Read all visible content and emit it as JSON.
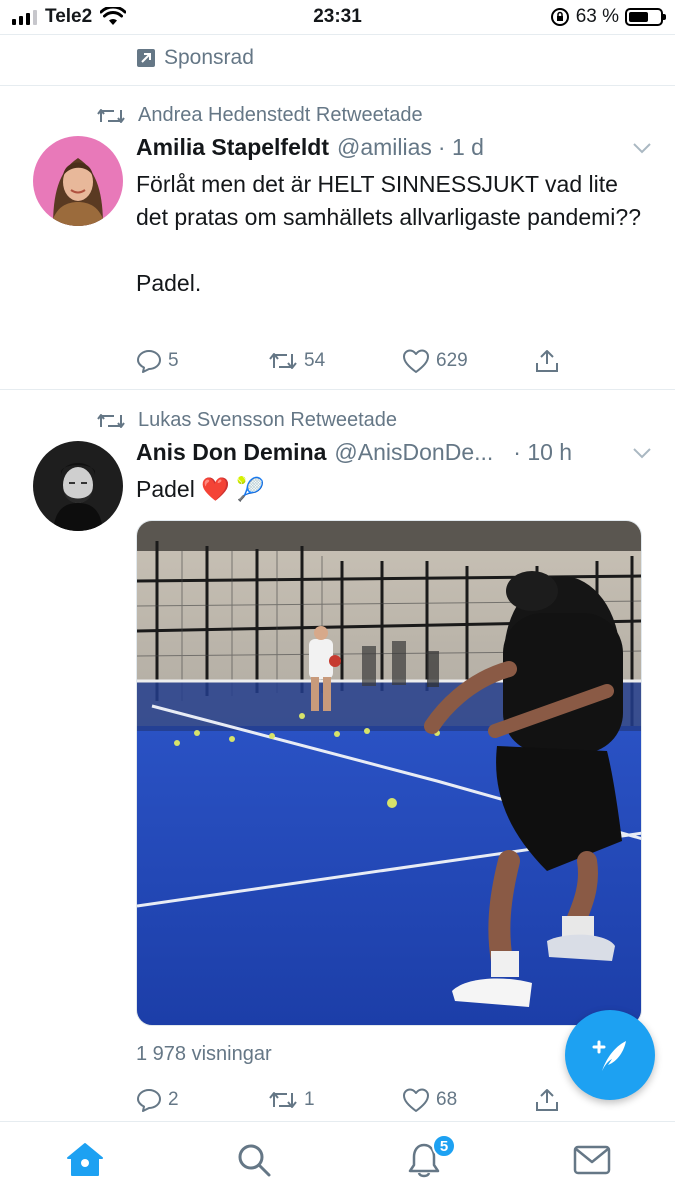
{
  "status_bar": {
    "carrier": "Tele2",
    "time": "23:31",
    "battery_percent": "63 %",
    "battery_level": 0.63
  },
  "sponsored": {
    "label": "Sponsrad"
  },
  "tweets": [
    {
      "retweeted_by": "Andrea Hedenstedt Retweetade",
      "name": "Amilia Stapelfeldt",
      "handle": "@amilias",
      "time": "· 1 d",
      "text": "Förlåt men det är HELT SINNESSJUKT vad lite det pratas om samhällets allvarligaste pandemi??\n\nPadel.",
      "replies": "5",
      "retweets": "54",
      "likes": "629"
    },
    {
      "retweeted_by": "Lukas  Svensson Retweetade",
      "name": "Anis Don Demina",
      "handle": "@AnisDonDe...",
      "time": "· 10 h",
      "text": "Padel ❤️ 🎾",
      "views": "1 978 visningar",
      "replies": "2",
      "retweets": "1",
      "likes": "68"
    }
  ],
  "tabbar": {
    "notification_count": "5",
    "items": [
      "home-icon",
      "search-icon",
      "bell-icon",
      "mail-icon"
    ]
  },
  "colors": {
    "accent": "#1da1f2",
    "muted": "#657786",
    "text": "#14171a",
    "divider": "#e6ecf0"
  }
}
